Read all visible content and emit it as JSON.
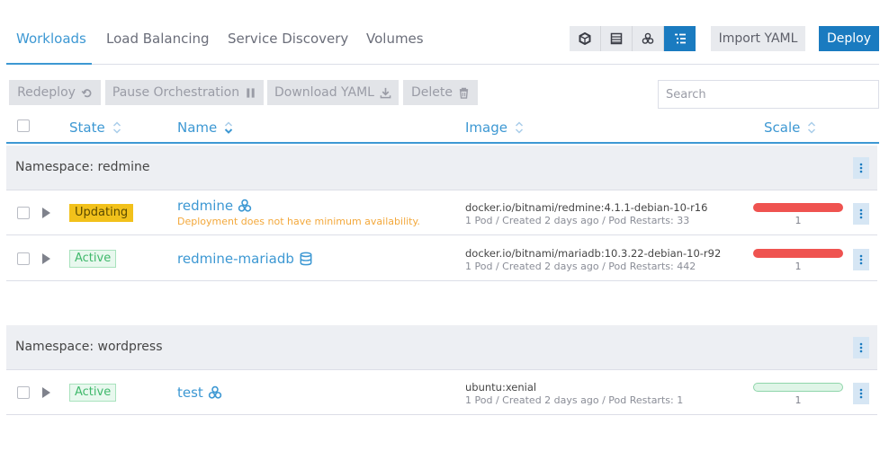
{
  "tabs": [
    {
      "label": "Workloads"
    },
    {
      "label": "Load Balancing"
    },
    {
      "label": "Service Discovery"
    },
    {
      "label": "Volumes"
    }
  ],
  "view_buttons": [
    {
      "icon": "node-cube-icon"
    },
    {
      "icon": "flat-list-icon"
    },
    {
      "icon": "workload-group-icon"
    },
    {
      "icon": "namespace-list-icon"
    }
  ],
  "actions": {
    "import_label": "Import YAML",
    "deploy_label": "Deploy"
  },
  "bulk_actions": [
    {
      "label": "Redeploy",
      "icon": "redeploy-icon"
    },
    {
      "label": "Pause Orchestration",
      "icon": "pause-icon"
    },
    {
      "label": "Download YAML",
      "icon": "download-icon"
    },
    {
      "label": "Delete",
      "icon": "trash-icon"
    }
  ],
  "search": {
    "placeholder": "Search",
    "value": ""
  },
  "columns": {
    "state": "State",
    "name": "Name",
    "image": "Image",
    "scale": "Scale"
  },
  "groups": [
    {
      "label": "Namespace: redmine",
      "rows": [
        {
          "state": "Updating",
          "state_type": "updating",
          "name": "redmine",
          "name_icon": "workload-group-icon",
          "warning": "Deployment does not have minimum availability.",
          "image": "docker.io/bitnami/redmine:4.1.1-debian-10-r16",
          "meta": "1 Pod / Created 2 days ago / Pod Restarts: 33",
          "scale": "1",
          "scale_status": "red"
        },
        {
          "state": "Active",
          "state_type": "active",
          "name": "redmine-mariadb",
          "name_icon": "database-icon",
          "warning": "",
          "image": "docker.io/bitnami/mariadb:10.3.22-debian-10-r92",
          "meta": "1 Pod / Created 2 days ago / Pod Restarts: 442",
          "scale": "1",
          "scale_status": "red"
        }
      ]
    },
    {
      "label": "Namespace: wordpress",
      "rows": [
        {
          "state": "Active",
          "state_type": "active",
          "name": "test",
          "name_icon": "workload-group-icon",
          "warning": "",
          "image": "ubuntu:xenial",
          "meta": "1 Pod / Created 2 days ago / Pod Restarts: 1",
          "scale": "1",
          "scale_status": "green"
        }
      ]
    }
  ],
  "colors": {
    "accent": "#3d98d3",
    "primary_button": "#1a7bc0",
    "updating": "#f2c11b",
    "active": "#3fb86b",
    "scale_red": "#ef5350"
  }
}
